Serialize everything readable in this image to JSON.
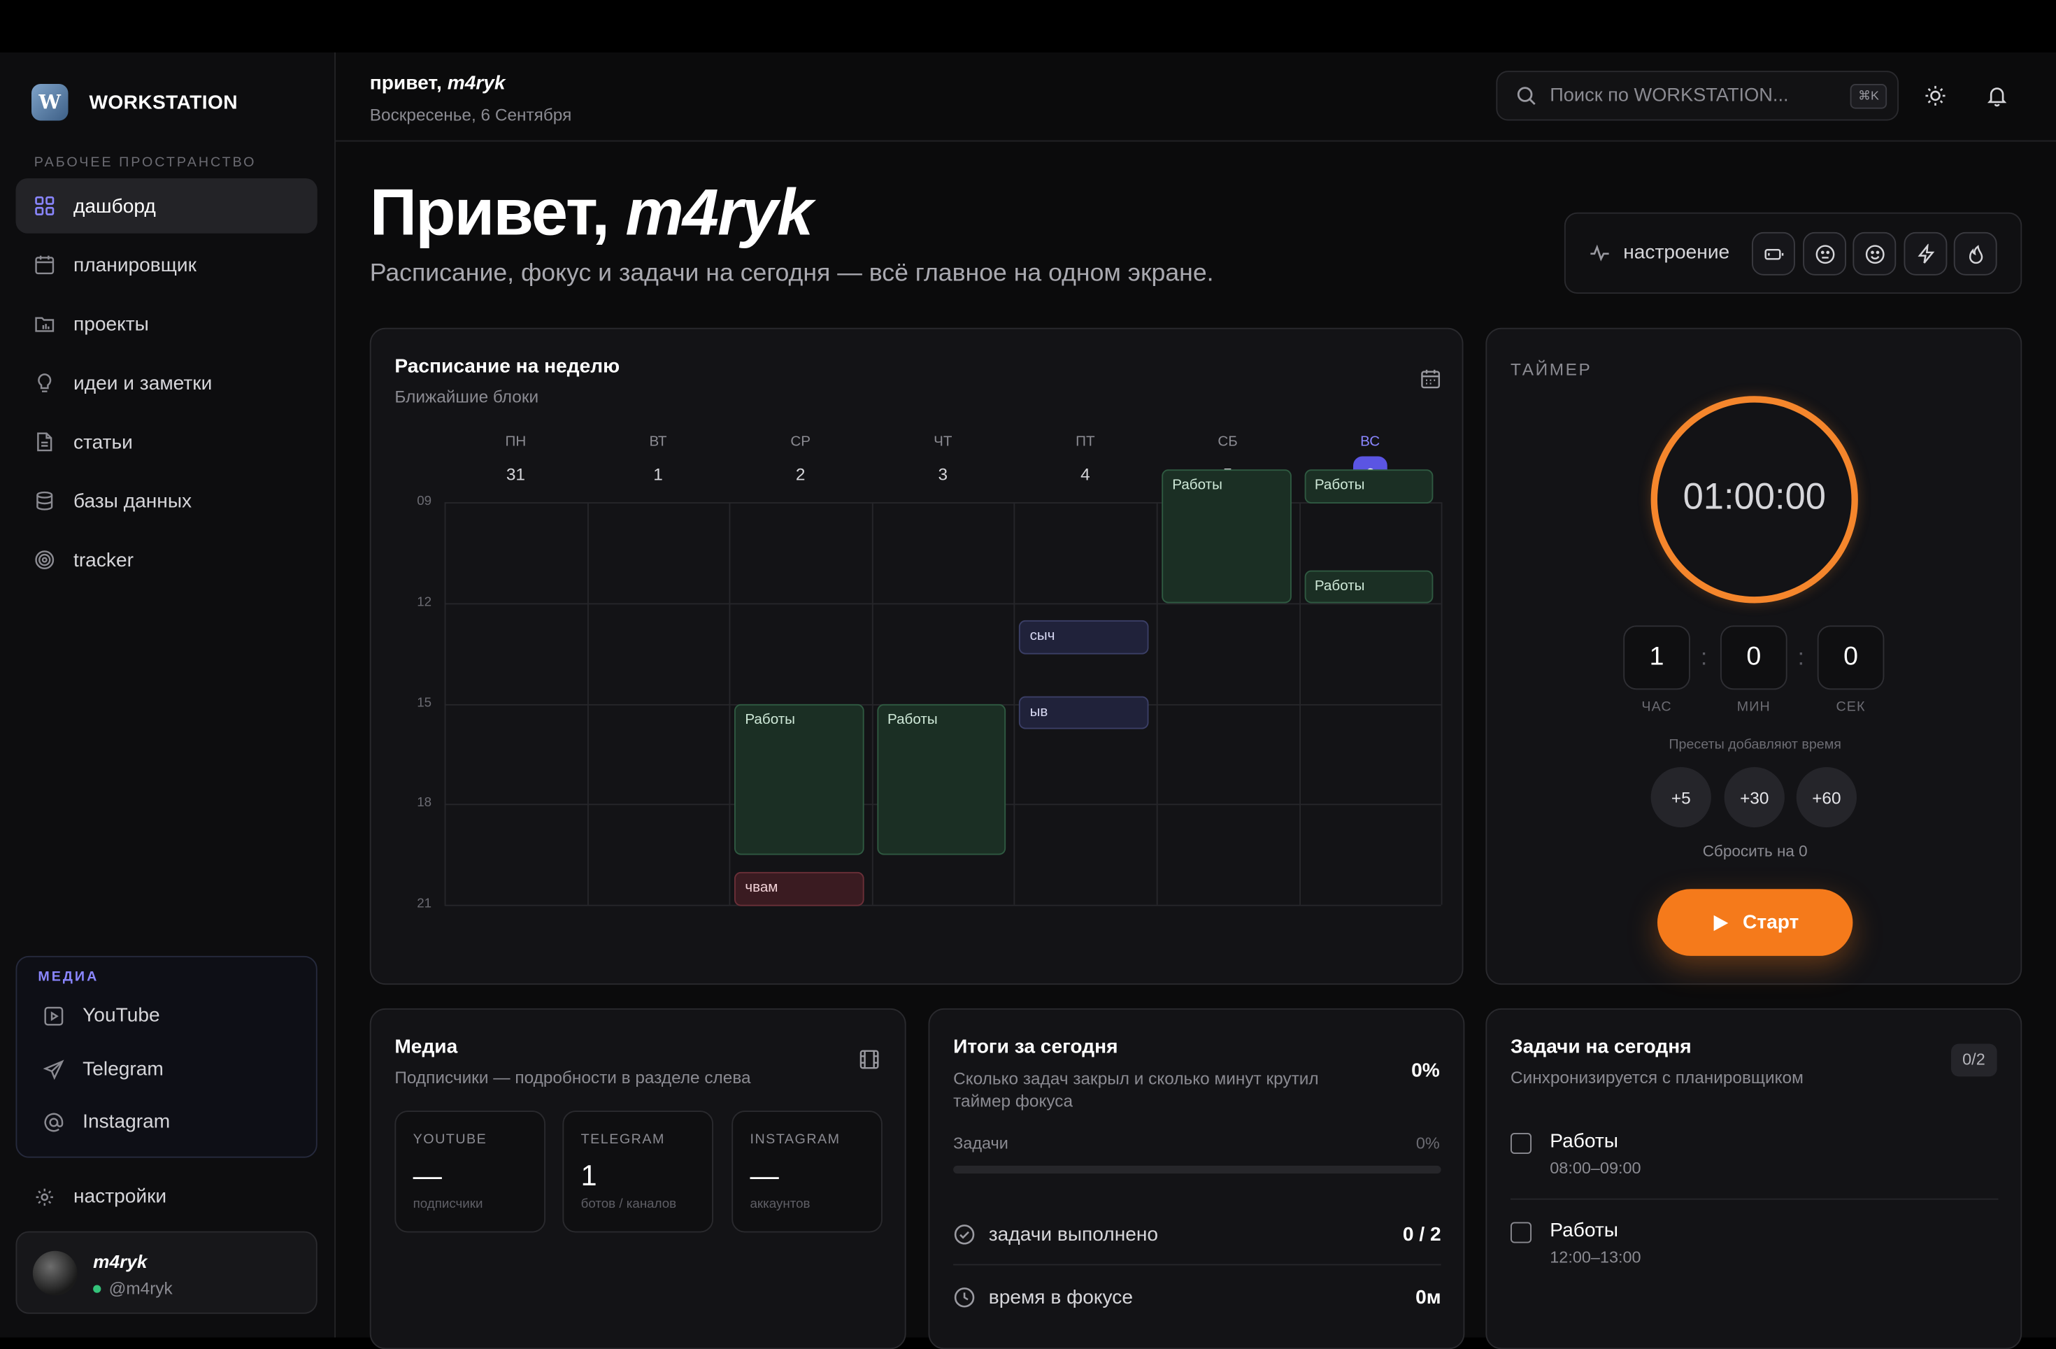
{
  "brand": {
    "name": "WORKSTATION",
    "logo_letter": "W"
  },
  "sidebar": {
    "section_label": "РАБОЧЕЕ ПРОСТРАНСТВО",
    "items": [
      {
        "label": "дашборд",
        "icon": "grid-icon",
        "active": true
      },
      {
        "label": "планировщик",
        "icon": "calendar-icon"
      },
      {
        "label": "проекты",
        "icon": "folder-icon"
      },
      {
        "label": "идеи и заметки",
        "icon": "lightbulb-icon"
      },
      {
        "label": "статьи",
        "icon": "document-icon"
      },
      {
        "label": "базы данных",
        "icon": "database-icon"
      },
      {
        "label": "tracker",
        "icon": "target-icon"
      }
    ],
    "media": {
      "label": "МЕДИА",
      "items": [
        {
          "label": "YouTube",
          "icon": "play-square-icon"
        },
        {
          "label": "Telegram",
          "icon": "send-icon"
        },
        {
          "label": "Instagram",
          "icon": "at-icon"
        }
      ]
    },
    "settings_label": "настройки",
    "user": {
      "name": "m4ryk",
      "handle": "@m4ryk",
      "status_color": "#34c37a"
    }
  },
  "header": {
    "greeting_prefix": "привет, ",
    "greeting_name": "m4ryk",
    "date": "Воскресенье, 6 Сентября",
    "search_placeholder": "Поиск по WORKSTATION...",
    "search_shortcut": "⌘K"
  },
  "hero": {
    "title_prefix": "Привет, ",
    "title_name": "m4ryk",
    "subtitle": "Расписание, фокус и задачи на сегодня — всё главное на одном экране."
  },
  "mood": {
    "label": "настроение",
    "options": [
      "battery-icon",
      "neutral-face-icon",
      "smile-icon",
      "lightning-icon",
      "flame-icon"
    ]
  },
  "schedule": {
    "title": "Расписание на неделю",
    "subtitle": "Ближайшие блоки",
    "days": [
      {
        "name": "ПН",
        "num": "31"
      },
      {
        "name": "ВТ",
        "num": "1"
      },
      {
        "name": "СР",
        "num": "2"
      },
      {
        "name": "ЧТ",
        "num": "3"
      },
      {
        "name": "ПТ",
        "num": "4"
      },
      {
        "name": "СБ",
        "num": "5"
      },
      {
        "name": "ВС",
        "num": "6",
        "today": true
      }
    ],
    "hours": [
      "09",
      "12",
      "15",
      "18",
      "21"
    ],
    "events": [
      {
        "label": "Работы",
        "day": 5,
        "start": 9.0,
        "end": 13.0,
        "color": "green"
      },
      {
        "label": "Работы",
        "day": 6,
        "start": 9.0,
        "end": 10.0,
        "color": "green"
      },
      {
        "label": "Работы",
        "day": 6,
        "start": 12.0,
        "end": 13.0,
        "color": "green"
      },
      {
        "label": "сыч",
        "day": 4,
        "start": 13.5,
        "end": 14.5,
        "color": "purple"
      },
      {
        "label": "ыв",
        "day": 4,
        "start": 15.75,
        "end": 16.75,
        "color": "purple"
      },
      {
        "label": "Работы",
        "day": 2,
        "start": 16.0,
        "end": 20.5,
        "color": "green"
      },
      {
        "label": "Работы",
        "day": 3,
        "start": 16.0,
        "end": 20.5,
        "color": "green"
      },
      {
        "label": "чвам",
        "day": 2,
        "start": 21.0,
        "end": 22.0,
        "color": "red"
      }
    ]
  },
  "timer": {
    "label": "ТАЙМЕР",
    "display": "01:00:00",
    "hours": "1",
    "minutes": "0",
    "seconds": "0",
    "unit_hours": "ЧАС",
    "unit_minutes": "МИН",
    "unit_seconds": "СЕК",
    "presets_hint": "Пресеты добавляют время",
    "presets": [
      "+5",
      "+30",
      "+60"
    ],
    "reset_label": "Сбросить на 0",
    "start_label": "Старт",
    "accent": "#f57a1b"
  },
  "media_card": {
    "title": "Медиа",
    "subtitle": "Подписчики — подробности в разделе слева",
    "stats": [
      {
        "name": "YOUTUBE",
        "value": "—",
        "caption": "подписчики"
      },
      {
        "name": "TELEGRAM",
        "value": "1",
        "caption": "ботов / каналов"
      },
      {
        "name": "INSTAGRAM",
        "value": "—",
        "caption": "аккаунтов"
      }
    ]
  },
  "summary": {
    "title": "Итоги за сегодня",
    "subtitle": "Сколько задач закрыл и сколько минут крутил таймер фокуса",
    "percent": "0%",
    "bar_label": "Задачи",
    "bar_percent": "0%",
    "progress": 0,
    "rows": [
      {
        "label": "задачи выполнено",
        "value": "0 / 2",
        "icon": "check-circle-icon"
      },
      {
        "label": "время в фокусе",
        "value": "0м",
        "icon": "clock-icon"
      }
    ]
  },
  "tasks": {
    "title": "Задачи на сегодня",
    "subtitle": "Синхронизируется с планировщиком",
    "count": "0/2",
    "items": [
      {
        "title": "Работы",
        "time": "08:00–09:00"
      },
      {
        "title": "Работы",
        "time": "12:00–13:00"
      }
    ]
  }
}
